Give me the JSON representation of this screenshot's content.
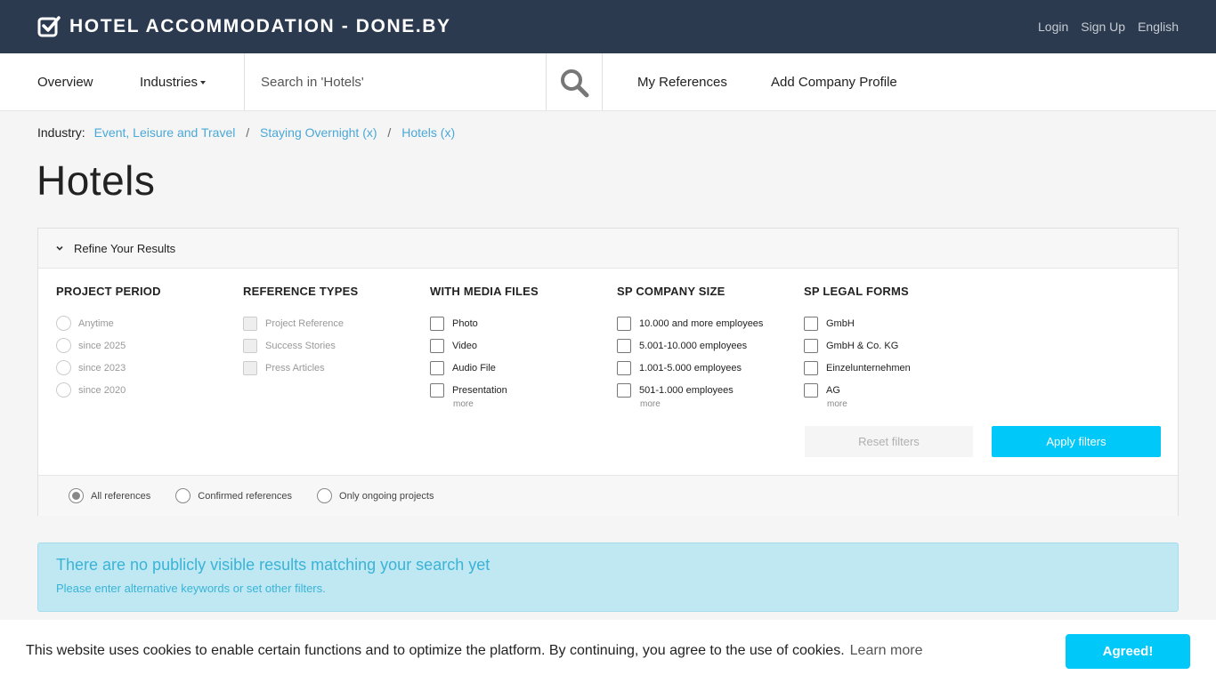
{
  "header": {
    "brand": "HOTEL ACCOMMODATION - DONE.BY",
    "links": [
      "Login",
      "Sign Up",
      "English"
    ]
  },
  "nav": {
    "overview": "Overview",
    "industries": "Industries",
    "search_placeholder": "Search in 'Hotels'",
    "my_references": "My References",
    "add_company_profile": "Add Company Profile"
  },
  "breadcrumb": {
    "label": "Industry:",
    "items": [
      "Event, Leisure and Travel",
      "Staying Overnight (x)",
      "Hotels (x)"
    ]
  },
  "page_title": "Hotels",
  "refine": {
    "title": "Refine Your Results",
    "columns": [
      {
        "title": "PROJECT PERIOD",
        "options": [
          "Anytime",
          "since 2025",
          "since 2023",
          "since 2020"
        ]
      },
      {
        "title": "REFERENCE TYPES",
        "options": [
          "Project Reference",
          "Success Stories",
          "Press Articles"
        ]
      },
      {
        "title": "WITH MEDIA FILES",
        "options": [
          "Photo",
          "Video",
          "Audio File",
          "Presentation"
        ],
        "more": "more"
      },
      {
        "title": "SP COMPANY SIZE",
        "options": [
          "10.000 and more employees",
          "5.001-10.000 employees",
          "1.001-5.000 employees",
          "501-1.000 employees"
        ],
        "more": "more"
      },
      {
        "title": "SP LEGAL FORMS",
        "options": [
          "GmbH",
          "GmbH & Co. KG",
          "Einzelunternehmen",
          "AG"
        ],
        "more": "more"
      }
    ],
    "reset_label": "Reset filters",
    "apply_label": "Apply filters",
    "reference_filter": [
      "All references",
      "Confirmed references",
      "Only ongoing projects"
    ]
  },
  "alert": {
    "title": "There are no publicly visible results matching your search yet",
    "text": "Please enter alternative keywords or set other filters."
  },
  "cookie": {
    "text": "This website uses cookies to enable certain functions and to optimize the platform. By continuing, you agree to the use of cookies.",
    "learn_more": "Learn more",
    "button": "Agreed!"
  },
  "colors": {
    "header_bg": "#2b3a4f",
    "accent": "#00c8f8",
    "link": "#4aa8d8",
    "alert_bg": "#bfe8f3"
  }
}
